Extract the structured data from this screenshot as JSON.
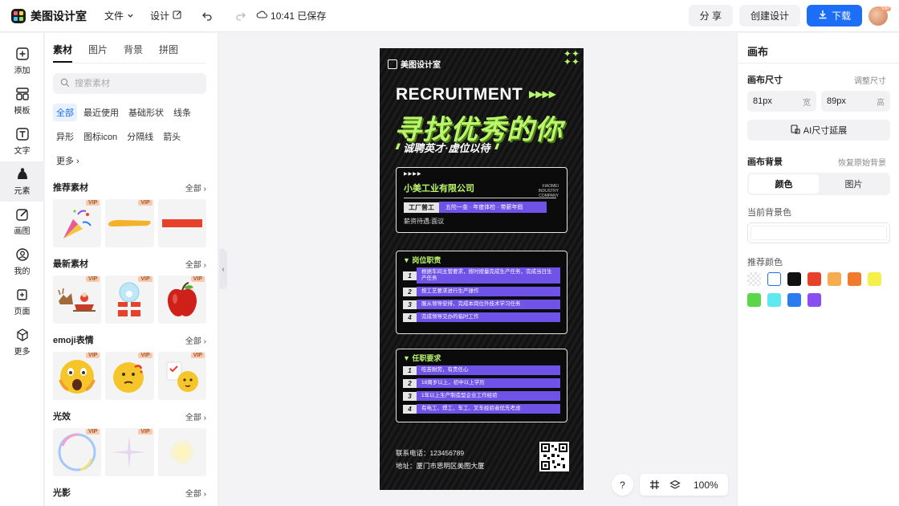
{
  "topbar": {
    "app_name": "美图设计室",
    "menu_file": "文件",
    "menu_design": "设计",
    "saved_text": "10:41 已保存",
    "share": "分 享",
    "create": "创建设计",
    "download": "下载",
    "avatar_badge": "VIP"
  },
  "rail": {
    "items": [
      {
        "label": "添加",
        "icon": "plus-square-icon"
      },
      {
        "label": "模板",
        "icon": "template-icon"
      },
      {
        "label": "文字",
        "icon": "text-icon"
      },
      {
        "label": "元素",
        "icon": "shapes-icon"
      },
      {
        "label": "画图",
        "icon": "pen-icon"
      },
      {
        "label": "我的",
        "icon": "user-icon"
      },
      {
        "label": "页面",
        "icon": "add-page-icon"
      },
      {
        "label": "更多",
        "icon": "cube-icon"
      }
    ],
    "active": "元素"
  },
  "panel": {
    "tabs": [
      "素材",
      "图片",
      "背景",
      "拼图"
    ],
    "active_tab": "素材",
    "search_placeholder": "搜索素材",
    "chips": [
      "全部",
      "最近使用",
      "基础形状",
      "线条",
      "异形",
      "图标icon",
      "分隔线",
      "箭头",
      "更多"
    ],
    "active_chip": "全部",
    "see_all": "全部",
    "vip": "VIP",
    "sections": [
      {
        "title": "推荐素材",
        "items": [
          "party-popper",
          "yellow-brush-stroke",
          "red-bar"
        ]
      },
      {
        "title": "最新素材",
        "items": [
          "santa-sleigh",
          "gift-snow-globe",
          "red-apple"
        ]
      },
      {
        "title": "emoji表情",
        "items": [
          "shocked-emoji",
          "thinking-emoji",
          "checklist-emoji"
        ]
      },
      {
        "title": "光效",
        "items": [
          "bubble-light",
          "sparkle-light",
          "glow-light"
        ]
      },
      {
        "title": "光影",
        "items": []
      }
    ]
  },
  "poster": {
    "brand": "美图设计室",
    "recruitment": "RECRUITMENT",
    "headline": "寻找优秀的你",
    "sub": "诚聘英才·虚位以待",
    "company": "小美工业有限公司",
    "company_en": "XIAOMEI INDUSTRY COMPANY",
    "job_tag": "工厂普工",
    "job_benefits": "五险一金 · 年度体检 · 带薪年假",
    "salary": "薪资待遇:面议",
    "duties_title": "岗位职责",
    "duties": [
      {
        "n": "1",
        "text": "根据车间主管要求，按时按量完成生产任务，完成当日生产任务"
      },
      {
        "n": "2",
        "text": "按工艺要求进行生产操作"
      },
      {
        "n": "3",
        "text": "服从领导安排，完成本岗位外技术学习任务"
      },
      {
        "n": "4",
        "text": "完成领导交办的临时工作"
      }
    ],
    "req_title": "任职要求",
    "requirements": [
      {
        "n": "1",
        "text": "吃苦耐劳，有责任心"
      },
      {
        "n": "2",
        "text": "18周岁以上，初中以上学历"
      },
      {
        "n": "3",
        "text": "1年以上生产制造型企业工作经验"
      },
      {
        "n": "4",
        "text": "有电工、焊工、车工、叉车经验者优先考虑"
      }
    ],
    "phone": "联系电话：123456789",
    "address": "地址：厦门市思明区美图大厦"
  },
  "float": {
    "help": "?",
    "zoom": "100%"
  },
  "right": {
    "title": "画布",
    "size_title": "画布尺寸",
    "size_adjust": "调整尺寸",
    "width_value": "81px",
    "width_unit": "宽",
    "height_value": "89px",
    "height_unit": "高",
    "ai_extend": "AI尺寸延展",
    "bg_title": "画布背景",
    "bg_restore": "恢复原始背景",
    "seg_color": "颜色",
    "seg_image": "图片",
    "current_bg": "当前背景色",
    "recommend": "推荐颜色",
    "colors": [
      "transparent",
      "#ffffff",
      "#111111",
      "#e8412b",
      "#f6ac4f",
      "#f07a2e",
      "#f8f04a",
      "#5bd64a",
      "#5ee8f0",
      "#2c7cf0",
      "#8a4df0"
    ]
  }
}
